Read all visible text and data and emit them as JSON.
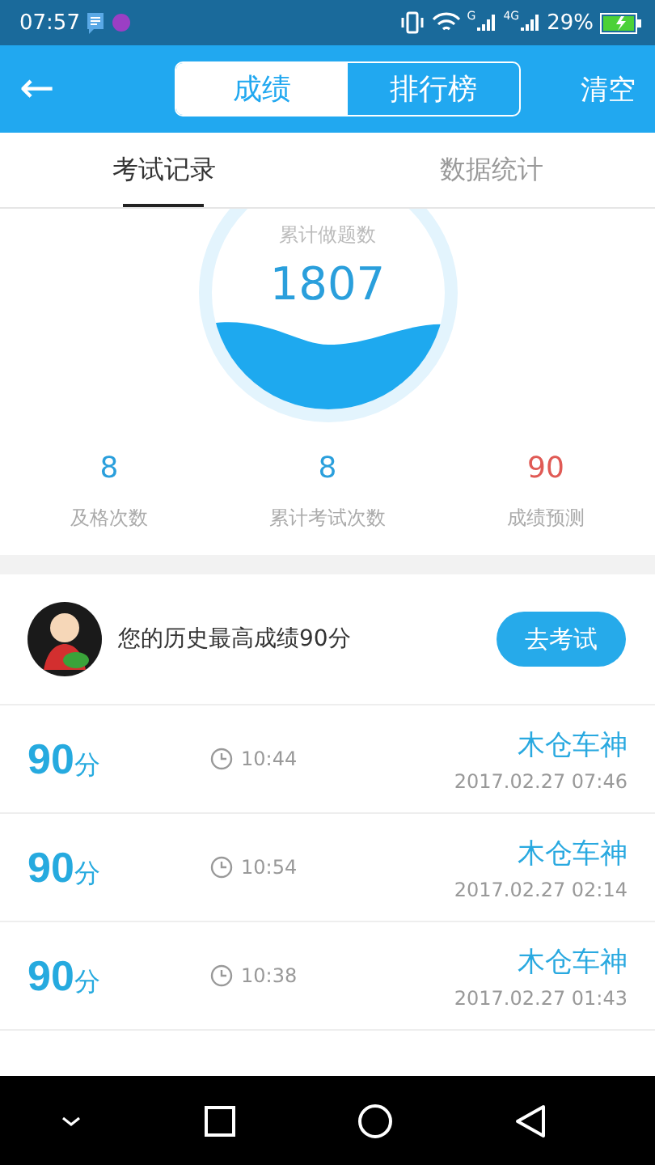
{
  "status_bar": {
    "time": "07:57",
    "network_1": "G",
    "network_2": "4G",
    "battery": "29%"
  },
  "header": {
    "back": "←",
    "segments": [
      {
        "label": "成绩",
        "selected": true
      },
      {
        "label": "排行榜",
        "selected": false
      }
    ],
    "action": "清空"
  },
  "tabs": [
    {
      "label": "考试记录",
      "selected": true
    },
    {
      "label": "数据统计",
      "selected": false
    }
  ],
  "gauge": {
    "label": "累计做题数",
    "value": "1807"
  },
  "stats": [
    {
      "value": "8",
      "label": "及格次数",
      "kind": "normal"
    },
    {
      "value": "8",
      "label": "累计考试次数",
      "kind": "normal"
    },
    {
      "value": "90",
      "label": "成绩预测",
      "kind": "highlight"
    }
  ],
  "best": {
    "text": "您的历史最高成绩90分",
    "button": "去考试"
  },
  "records": [
    {
      "score": "90",
      "unit": "分",
      "duration": "10:44",
      "name": "木仓车神",
      "date": "2017.02.27  07:46"
    },
    {
      "score": "90",
      "unit": "分",
      "duration": "10:54",
      "name": "木仓车神",
      "date": "2017.02.27  02:14"
    },
    {
      "score": "90",
      "unit": "分",
      "duration": "10:38",
      "name": "木仓车神",
      "date": "2017.02.27  01:43"
    }
  ]
}
